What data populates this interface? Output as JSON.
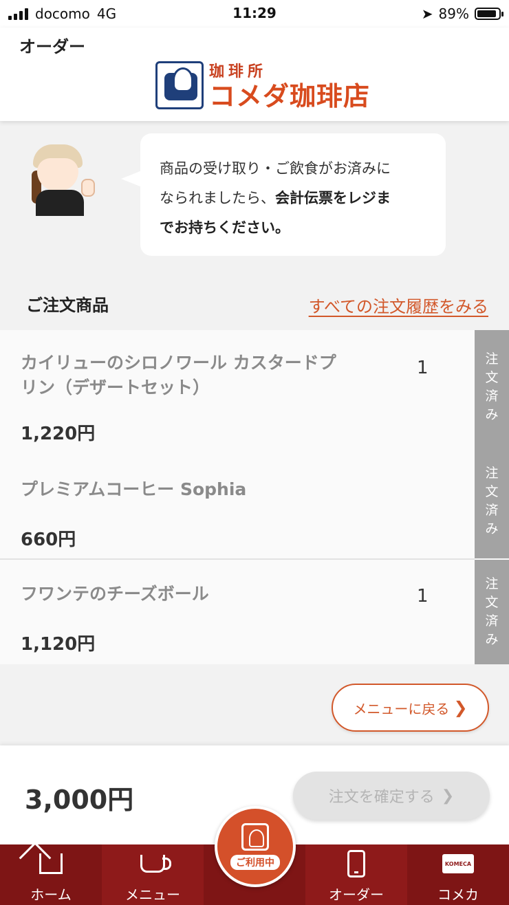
{
  "status": {
    "carrier": "docomo",
    "network": "4G",
    "time": "11:29",
    "battery": "89%",
    "battery_level": 0.89
  },
  "header": {
    "title": "オーダー",
    "logo_sub": "珈琲所",
    "logo_main": "コメダ珈琲店"
  },
  "notice": {
    "line1": "商品の受け取り・ご飲食がお済みに",
    "line2_normal": "なられましたら、",
    "line2_bold": "会計伝票をレジま",
    "line3_bold": "でお持ちください。"
  },
  "orders": {
    "section_title": "ご注文商品",
    "history_link": "すべての注文履歴をみる",
    "items": [
      {
        "name": "カイリューのシロノワール カスタードプリン（デザートセット）",
        "qty": "1",
        "price": "1,220円"
      },
      {
        "name": "プレミアムコーヒー Sophia",
        "qty": "",
        "price": "660円"
      },
      {
        "name": "フワンテのチーズボール",
        "qty": "1",
        "price": "1,120円"
      }
    ],
    "status_chars": [
      "注",
      "文",
      "済",
      "み"
    ]
  },
  "back_button": {
    "label": "メニューに戻る",
    "chevron": "❯"
  },
  "footer": {
    "total": "3,000円",
    "confirm_label": "注文を確定する",
    "chevron": "❯"
  },
  "tabbar": {
    "home": "ホーム",
    "menu": "メニュー",
    "center": "ご利用中",
    "order": "オーダー",
    "komeca": "コメカ",
    "card_text": "KOMECA"
  },
  "colors": {
    "accent": "#d2582a",
    "tabbar": "#8e1a1a",
    "ordered_badge": "#a3a3a3",
    "logo_blue": "#1f3f7a"
  }
}
